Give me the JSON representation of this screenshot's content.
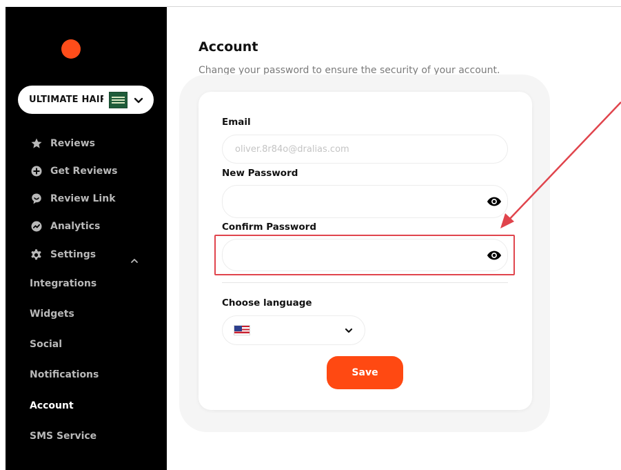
{
  "sidebar": {
    "business_name": "ULTIMATE HAIR & BEAUTY",
    "nav": [
      {
        "label": "Reviews",
        "icon": "star-icon"
      },
      {
        "label": "Get Reviews",
        "icon": "plus-circle-icon"
      },
      {
        "label": "Review Link",
        "icon": "chat-bubble-icon"
      },
      {
        "label": "Analytics",
        "icon": "chart-icon"
      },
      {
        "label": "Settings",
        "icon": "gear-icon"
      }
    ],
    "settings_items": [
      "Integrations",
      "Widgets",
      "Social",
      "Notifications",
      "Account",
      "SMS Service"
    ],
    "active_item": "Account"
  },
  "main": {
    "title": "Account",
    "subtitle": "Change your password to ensure the security of your account.",
    "email": {
      "label": "Email",
      "placeholder": "oliver.8r84o@dralias.com"
    },
    "new_password": {
      "label": "New Password",
      "value": ""
    },
    "confirm_password": {
      "label": "Confirm Password",
      "value": ""
    },
    "language": {
      "label": "Choose language",
      "selected_flag": "us-flag-icon"
    },
    "save_label": "Save"
  },
  "colors": {
    "accent": "#ff4912",
    "sidebar_bg": "#000000",
    "annotation": "#e0444c"
  }
}
